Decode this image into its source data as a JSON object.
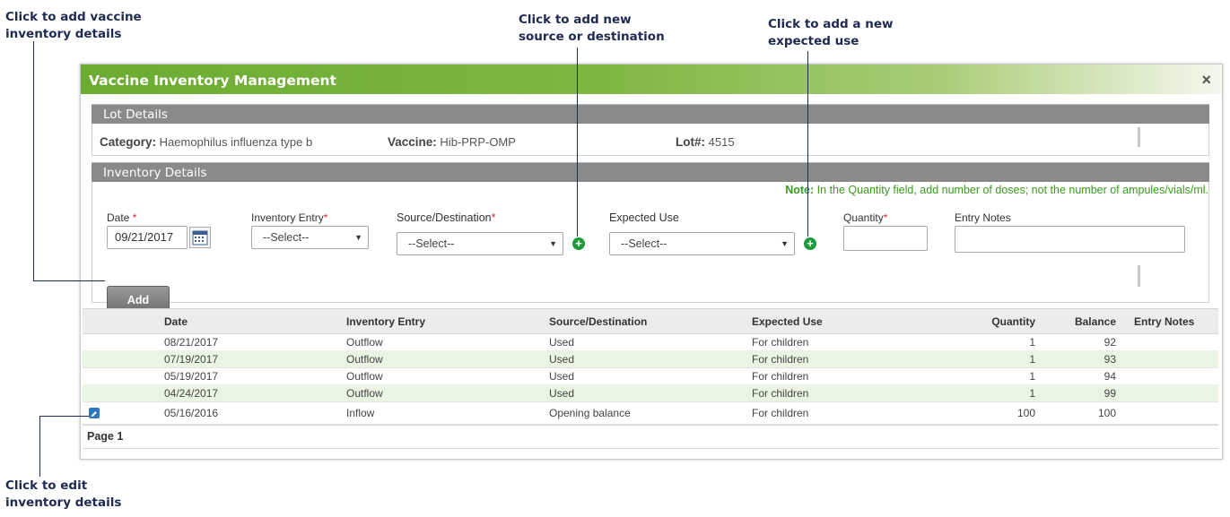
{
  "callouts": {
    "add_vaccine_line1": "Click to add vaccine",
    "add_vaccine_line2": "inventory details",
    "add_source_line1": "Click to add new",
    "add_source_line2": "source or destination",
    "add_use_line1": "Click to add a new",
    "add_use_line2": "expected use",
    "edit_line1": "Click to edit",
    "edit_line2": "inventory details"
  },
  "dialog": {
    "title": "Vaccine Inventory Management",
    "close_glyph": "×"
  },
  "lot_details": {
    "header": "Lot Details",
    "category_label": "Category:",
    "category_value": "Haemophilus influenza type b",
    "vaccine_label": "Vaccine:",
    "vaccine_value": "Hib-PRP-OMP",
    "lot_label": "Lot#:",
    "lot_value": "4515"
  },
  "inventory_details": {
    "header": "Inventory Details",
    "note_label": "Note:",
    "note_text": " In the Quantity field, add number of doses; not the number of ampules/vials/ml.",
    "date_label": "Date",
    "date_value": "09/21/2017",
    "inventory_entry_label": "Inventory Entry",
    "inventory_entry_value": "--Select--",
    "source_label": "Source/Destination",
    "source_value": "--Select--",
    "expected_use_label": "Expected Use",
    "expected_use_value": "--Select--",
    "quantity_label": "Quantity",
    "quantity_value": "",
    "entry_notes_label": "Entry Notes",
    "required_mark": "*",
    "add_button": "Add"
  },
  "grid": {
    "columns": [
      "Date",
      "Inventory Entry",
      "Source/Destination",
      "Expected Use",
      "Quantity",
      "Balance",
      "Entry Notes"
    ],
    "rows": [
      {
        "date": "08/21/2017",
        "entry": "Outflow",
        "source": "Used",
        "use": "For children",
        "quantity": "1",
        "balance": "92",
        "notes": ""
      },
      {
        "date": "07/19/2017",
        "entry": "Outflow",
        "source": "Used",
        "use": "For children",
        "quantity": "1",
        "balance": "93",
        "notes": ""
      },
      {
        "date": "05/19/2017",
        "entry": "Outflow",
        "source": "Used",
        "use": "For children",
        "quantity": "1",
        "balance": "94",
        "notes": ""
      },
      {
        "date": "04/24/2017",
        "entry": "Outflow",
        "source": "Used",
        "use": "For children",
        "quantity": "1",
        "balance": "99",
        "notes": ""
      },
      {
        "date": "05/16/2016",
        "entry": "Inflow",
        "source": "Opening balance",
        "use": "For children",
        "quantity": "100",
        "balance": "100",
        "notes": ""
      }
    ],
    "pager": "Page 1"
  },
  "colors": {
    "title_green": "#6cac31",
    "note_green": "#3a9a1e",
    "plus_green": "#1e9a3a",
    "row_alt": "#eaf4e2",
    "callout_navy": "#1f2a52"
  },
  "icons": {
    "calendar": "calendar-icon",
    "add": "plus-circle-icon",
    "edit": "pencil-icon",
    "close": "close-icon"
  }
}
